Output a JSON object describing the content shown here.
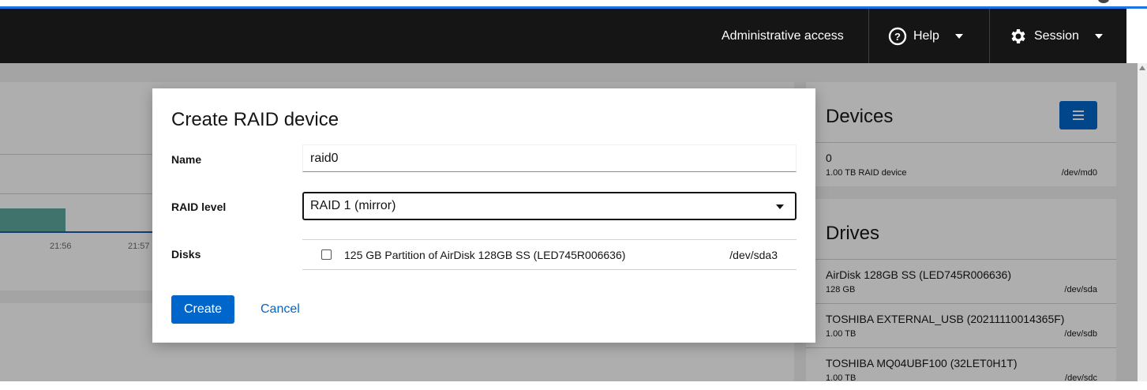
{
  "masthead": {
    "admin_label": "Administrative access",
    "help_label": "Help",
    "session_label": "Session"
  },
  "background": {
    "chart_ticks": [
      "21:56",
      "21:57"
    ],
    "devices": {
      "title": "Devices",
      "items": [
        {
          "name": "0",
          "desc": "1.00 TB RAID device",
          "path": "/dev/md0"
        }
      ]
    },
    "drives": {
      "title": "Drives",
      "items": [
        {
          "name": "AirDisk 128GB SS (LED745R006636)",
          "size": "128 GB",
          "path": "/dev/sda"
        },
        {
          "name": "TOSHIBA EXTERNAL_USB (20211110014365F)",
          "size": "1.00 TB",
          "path": "/dev/sdb"
        },
        {
          "name": "TOSHIBA MQ04UBF100 (32LET0H1T)",
          "size": "1.00 TB",
          "path": "/dev/sdc"
        }
      ]
    }
  },
  "dialog": {
    "title": "Create RAID device",
    "name_label": "Name",
    "name_value": "raid0",
    "raid_level_label": "RAID level",
    "raid_level_value": "RAID 1 (mirror)",
    "disks_label": "Disks",
    "disks": [
      {
        "label": "125 GB Partition of AirDisk 128GB SS (LED745R006636)",
        "path": "/dev/sda3",
        "checked": false
      }
    ],
    "create_label": "Create",
    "cancel_label": "Cancel"
  },
  "colors": {
    "primary": "#0066cc",
    "masthead": "#151515",
    "accent_line": "#1a73e8"
  }
}
